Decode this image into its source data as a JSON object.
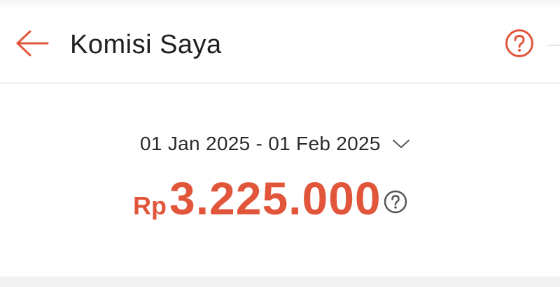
{
  "header": {
    "title": "Komisi Saya",
    "back_icon": "arrow-left-icon",
    "help_icon": "question-circle-icon"
  },
  "summary": {
    "date_range": "01 Jan 2025 - 01 Feb 2025",
    "currency": "Rp",
    "amount": "3.225.000",
    "info_icon": "question-circle-icon",
    "dropdown_icon": "chevron-down-icon"
  },
  "colors": {
    "accent": "#e1563a",
    "text": "#1f1f1f",
    "divider": "#eeeeee"
  }
}
